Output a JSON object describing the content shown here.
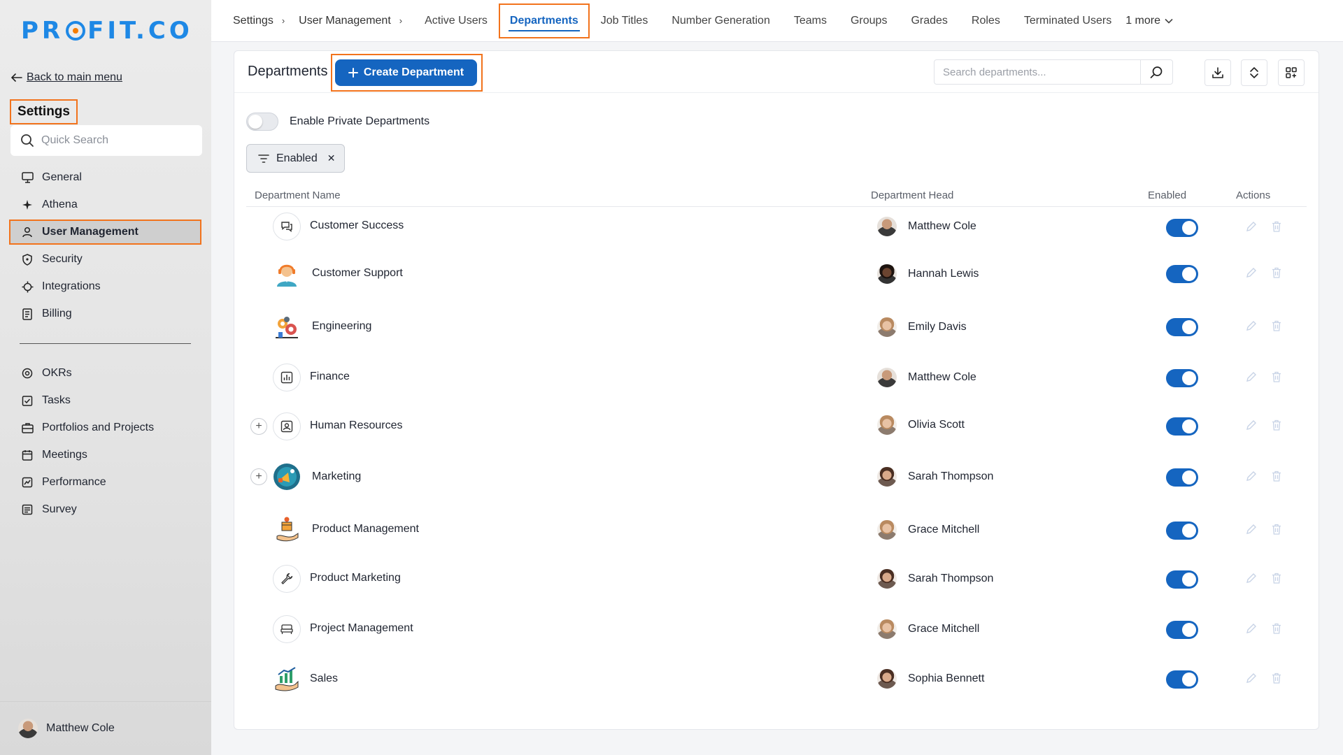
{
  "brand": {
    "logo_text_left": "PR",
    "logo_text_right": "FIT.CO"
  },
  "sidebar": {
    "back_label": "Back to main menu",
    "section_title": "Settings",
    "search_placeholder": "Quick Search",
    "items_top": [
      {
        "label": "General",
        "icon": "monitor-icon"
      },
      {
        "label": "Athena",
        "icon": "sparkle-icon"
      },
      {
        "label": "User Management",
        "icon": "user-icon",
        "active": true
      },
      {
        "label": "Security",
        "icon": "shield-icon"
      },
      {
        "label": "Integrations",
        "icon": "plug-icon"
      },
      {
        "label": "Billing",
        "icon": "receipt-icon"
      }
    ],
    "items_bottom": [
      {
        "label": "OKRs",
        "icon": "target-icon"
      },
      {
        "label": "Tasks",
        "icon": "task-icon"
      },
      {
        "label": "Portfolios and Projects",
        "icon": "briefcase-icon"
      },
      {
        "label": "Meetings",
        "icon": "calendar-icon"
      },
      {
        "label": "Performance",
        "icon": "chart-icon"
      },
      {
        "label": "Survey",
        "icon": "survey-icon"
      }
    ],
    "user_name": "Matthew Cole"
  },
  "topnav": {
    "breadcrumbs": [
      "Settings",
      "User Management"
    ],
    "tabs": [
      "Active Users",
      "Departments",
      "Job Titles",
      "Number Generation",
      "Teams",
      "Groups",
      "Grades",
      "Roles",
      "Terminated Users"
    ],
    "active_tab": "Departments",
    "more_label": "1 more"
  },
  "card": {
    "title": "Departments",
    "create_label": "Create Department",
    "search_placeholder": "Search departments...",
    "private_toggle_label": "Enable Private Departments",
    "filter_chip": "Enabled"
  },
  "table": {
    "columns": {
      "name": "Department Name",
      "head": "Department Head",
      "enabled": "Enabled",
      "actions": "Actions"
    },
    "rows": [
      {
        "name": "Customer Success",
        "head": "Matthew Cole",
        "icon": "chat-icon",
        "expandable": false,
        "enabled": true
      },
      {
        "name": "Customer Support",
        "head": "Hannah Lewis",
        "icon": "support-agent-icon",
        "expandable": false,
        "enabled": true
      },
      {
        "name": "Engineering",
        "head": "Emily Davis",
        "icon": "engineering-icon",
        "expandable": false,
        "enabled": true
      },
      {
        "name": "Finance",
        "head": "Matthew Cole",
        "icon": "bar-chart-icon",
        "expandable": false,
        "enabled": true
      },
      {
        "name": "Human Resources",
        "head": "Olivia Scott",
        "icon": "id-badge-icon",
        "expandable": true,
        "enabled": true
      },
      {
        "name": "Marketing",
        "head": "Sarah Thompson",
        "icon": "megaphone-icon",
        "expandable": true,
        "enabled": true
      },
      {
        "name": "Product Management",
        "head": "Grace Mitchell",
        "icon": "product-box-icon",
        "expandable": false,
        "enabled": true
      },
      {
        "name": "Product Marketing",
        "head": "Sarah Thompson",
        "icon": "wrench-icon",
        "expandable": false,
        "enabled": true
      },
      {
        "name": "Project Management",
        "head": "Grace Mitchell",
        "icon": "bed-icon",
        "expandable": false,
        "enabled": true
      },
      {
        "name": "Sales",
        "head": "Sophia Bennett",
        "icon": "sales-growth-icon",
        "expandable": false,
        "enabled": true
      }
    ]
  },
  "colors": {
    "accent": "#1565c0",
    "highlight": "#f2731c",
    "logo_blue": "#1e88e5"
  }
}
